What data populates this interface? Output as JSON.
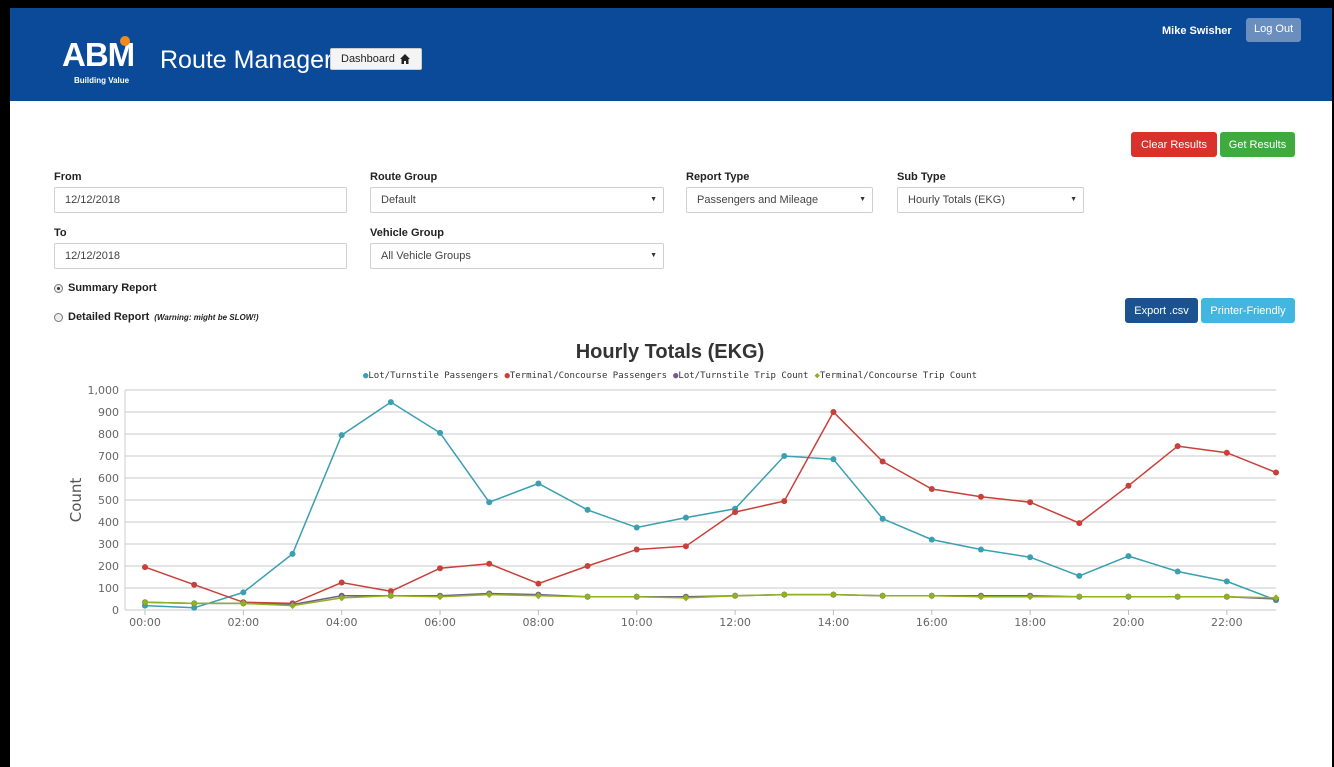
{
  "header": {
    "logo_text": "ABM",
    "logo_tagline": "Building Value",
    "app_title": "Route Manager",
    "dashboard_label": "Dashboard",
    "user_name": "Mike Swisher",
    "logout_label": "Log Out"
  },
  "actions": {
    "clear_label": "Clear Results",
    "get_label": "Get Results",
    "export_label": "Export .csv",
    "print_label": "Printer-Friendly"
  },
  "form": {
    "from_label": "From",
    "from_value": "12/12/2018",
    "to_label": "To",
    "to_value": "12/12/2018",
    "route_group_label": "Route Group",
    "route_group_value": "Default",
    "vehicle_group_label": "Vehicle Group",
    "vehicle_group_value": "All Vehicle Groups",
    "report_type_label": "Report Type",
    "report_type_value": "Passengers and Mileage",
    "sub_type_label": "Sub Type",
    "sub_type_value": "Hourly Totals (EKG)",
    "summary_label": "Summary Report",
    "detailed_label": "Detailed Report",
    "detailed_warning": "(Warning: might be SLOW!)",
    "summary_checked": true
  },
  "icons": {
    "dashboard": "home-icon",
    "caret": "caret-down-icon"
  },
  "colors": {
    "header_bg": "#0b4a99",
    "clear": "#d9312b",
    "get": "#3fab3e",
    "export": "#1a5390",
    "print": "#42b6e0"
  },
  "chart_data": {
    "type": "line",
    "title": "Hourly Totals (EKG)",
    "ylabel": "Count",
    "xlabel": "",
    "ylim": [
      0,
      1000
    ],
    "y_ticks": [
      "0",
      "100",
      "200",
      "300",
      "400",
      "500",
      "600",
      "700",
      "800",
      "900",
      "1,000"
    ],
    "x_tick_labels": [
      "00:00",
      "02:00",
      "04:00",
      "06:00",
      "08:00",
      "10:00",
      "12:00",
      "14:00",
      "16:00",
      "18:00",
      "20:00",
      "22:00"
    ],
    "grid": true,
    "legend_position": "top",
    "categories": [
      "00:00",
      "01:00",
      "02:00",
      "03:00",
      "04:00",
      "05:00",
      "06:00",
      "07:00",
      "08:00",
      "09:00",
      "10:00",
      "11:00",
      "12:00",
      "13:00",
      "14:00",
      "15:00",
      "16:00",
      "17:00",
      "18:00",
      "19:00",
      "20:00",
      "21:00",
      "22:00",
      "23:00"
    ],
    "series": [
      {
        "name": "Lot/Turnstile Passengers",
        "color": "#3a9fb0",
        "marker": "circle",
        "values": [
          20,
          10,
          80,
          255,
          795,
          945,
          805,
          490,
          575,
          455,
          375,
          420,
          460,
          700,
          685,
          415,
          320,
          275,
          240,
          155,
          245,
          175,
          130,
          45
        ]
      },
      {
        "name": "Terminal/Concourse Passengers",
        "color": "#c9403a",
        "marker": "circle",
        "values": [
          195,
          115,
          35,
          30,
          125,
          85,
          190,
          210,
          120,
          200,
          275,
          290,
          445,
          495,
          900,
          675,
          550,
          515,
          490,
          395,
          565,
          745,
          715,
          625
        ]
      },
      {
        "name": "Lot/Turnstile Trip Count",
        "color": "#7a5a8c",
        "marker": "circle",
        "values": [
          35,
          30,
          30,
          25,
          65,
          65,
          65,
          75,
          70,
          60,
          60,
          60,
          65,
          70,
          70,
          65,
          65,
          65,
          65,
          60,
          60,
          60,
          60,
          50
        ]
      },
      {
        "name": "Terminal/Concourse Trip Count",
        "color": "#8db31e",
        "marker": "diamond",
        "values": [
          35,
          30,
          30,
          20,
          55,
          65,
          60,
          70,
          65,
          60,
          60,
          55,
          65,
          70,
          70,
          65,
          65,
          60,
          60,
          60,
          60,
          60,
          60,
          55
        ]
      }
    ]
  }
}
